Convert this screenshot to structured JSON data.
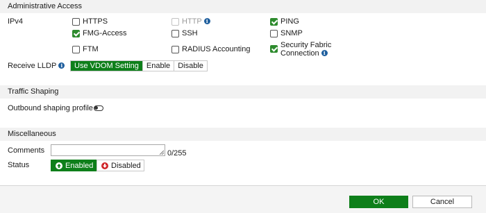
{
  "admin_access": {
    "header": "Administrative Access",
    "ipv4_label": "IPv4",
    "options": {
      "https": {
        "label": "HTTPS",
        "checked": false,
        "disabled": false
      },
      "http": {
        "label": "HTTP",
        "checked": false,
        "disabled": true
      },
      "ping": {
        "label": "PING",
        "checked": true,
        "disabled": false
      },
      "fmg_access": {
        "label": "FMG-Access",
        "checked": true,
        "disabled": false
      },
      "ssh": {
        "label": "SSH",
        "checked": false,
        "disabled": false
      },
      "snmp": {
        "label": "SNMP",
        "checked": false,
        "disabled": false
      },
      "ftm": {
        "label": "FTM",
        "checked": false,
        "disabled": false
      },
      "radius": {
        "label": "RADIUS Accounting",
        "checked": false,
        "disabled": false
      },
      "security_fabric": {
        "label_line1": "Security Fabric",
        "label_line2": "Connection",
        "checked": true,
        "disabled": false
      }
    },
    "receive_lldp_label": "Receive LLDP",
    "lldp_options": [
      "Use VDOM Setting",
      "Enable",
      "Disable"
    ],
    "lldp_selected": "Use VDOM Setting"
  },
  "traffic_shaping": {
    "header": "Traffic Shaping",
    "outbound_label": "Outbound shaping profile",
    "outbound_enabled": false
  },
  "misc": {
    "header": "Miscellaneous",
    "comments_label": "Comments",
    "comments_value": "",
    "comments_count": "0/255",
    "status_label": "Status",
    "status_enabled_label": "Enabled",
    "status_disabled_label": "Disabled",
    "status_selected": "Enabled"
  },
  "footer": {
    "ok_label": "OK",
    "cancel_label": "Cancel"
  },
  "colors": {
    "accent_green": "#0e7f1a",
    "checkbox_green": "#2e8b2e",
    "info_blue": "#1f5f9e",
    "disabled_red": "#d0262a"
  }
}
